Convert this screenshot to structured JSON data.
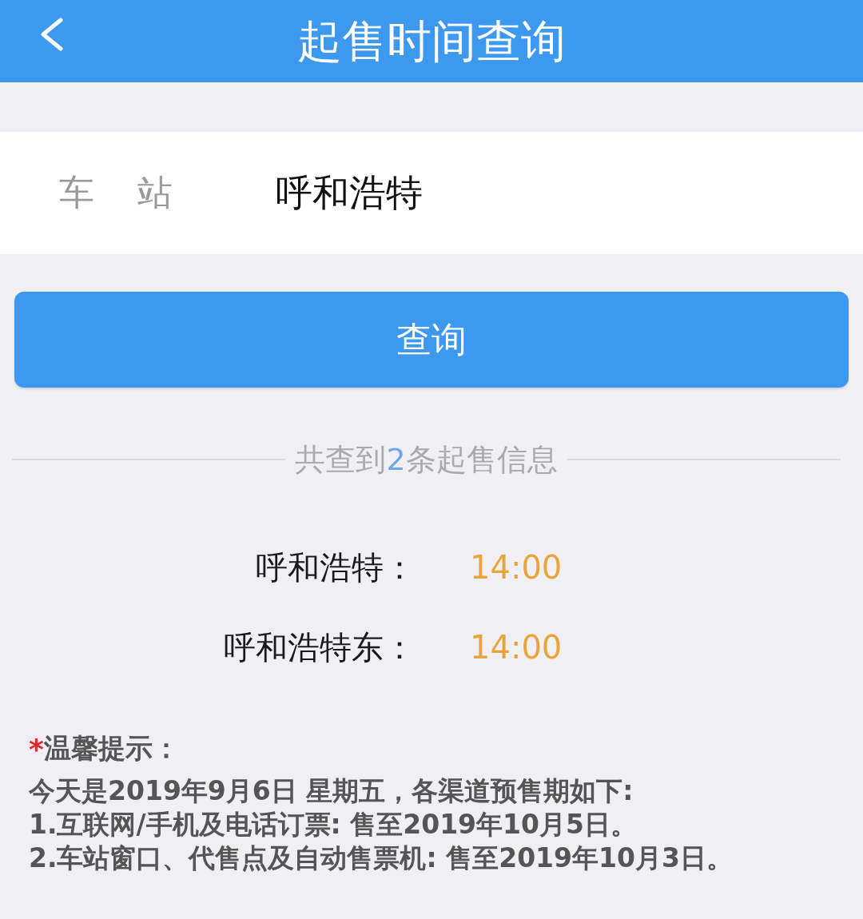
{
  "header": {
    "title": "起售时间查询"
  },
  "station_field": {
    "label": "车 站",
    "value": "呼和浩特"
  },
  "query_button": {
    "label": "查询"
  },
  "result_summary": {
    "prefix": "共查到",
    "count": "2",
    "suffix": "条起售信息"
  },
  "results": [
    {
      "station": "呼和浩特：",
      "time": "14:00"
    },
    {
      "station": "呼和浩特东：",
      "time": "14:00"
    }
  ],
  "notice": {
    "marker": "*",
    "title": "温馨提示：",
    "lines": [
      "今天是2019年9月6日 星期五，各渠道预售期如下:",
      "1.互联网/手机及电话订票: 售至2019年10月5日。",
      "2.车站窗口、代售点及自动售票机: 售至2019年10月3日。"
    ]
  }
}
